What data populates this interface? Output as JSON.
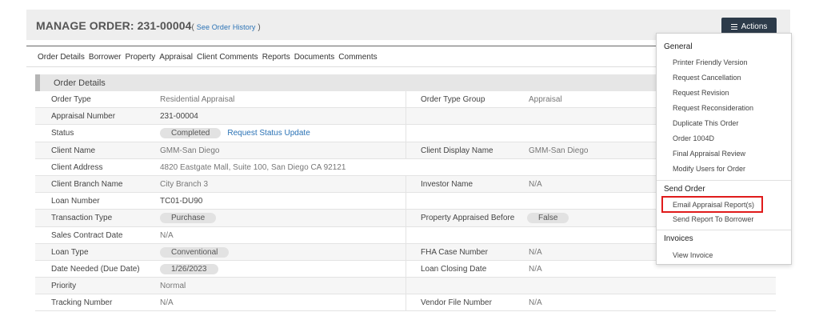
{
  "header": {
    "title_prefix": "MANAGE ORDER: ",
    "order_number": "231-00004",
    "history_open": "( ",
    "history_link": "See Order History",
    "history_close": " )",
    "actions_label": "Actions"
  },
  "tabs": [
    "Order Details",
    "Borrower",
    "Property",
    "Appraisal",
    "Client Comments",
    "Reports",
    "Documents",
    "Comments"
  ],
  "section": {
    "title": "Order Details"
  },
  "rows": [
    {
      "l1": "Order Type",
      "v1": "Residential Appraisal",
      "l2": "Order Type Group",
      "v2": "Appraisal"
    },
    {
      "l1": "Appraisal Number",
      "v1": "231-00004",
      "l2": "",
      "v2": ""
    },
    {
      "l1": "Status",
      "v1": "Completed",
      "v1_link": "Request Status Update",
      "l2": "",
      "v2": ""
    },
    {
      "l1": "Client Name",
      "v1": "GMM-San Diego",
      "l2": "Client Display Name",
      "v2": "GMM-San Diego"
    },
    {
      "l1": "Client Address",
      "v1": "4820 Eastgate Mall, Suite 100, San Diego CA 92121",
      "l2": "",
      "v2": ""
    },
    {
      "l1": "Client Branch Name",
      "v1": "City Branch 3",
      "l2": "Investor Name",
      "v2": "N/A"
    },
    {
      "l1": "Loan Number",
      "v1": "TC01-DU90",
      "l2": "",
      "v2": ""
    },
    {
      "l1": "Transaction Type",
      "v1": "Purchase",
      "l2": "Property Appraised Before",
      "v2": "False"
    },
    {
      "l1": "Sales Contract Date",
      "v1": "N/A",
      "l2": "",
      "v2": ""
    },
    {
      "l1": "Loan Type",
      "v1": "Conventional",
      "l2": "FHA Case Number",
      "v2": "N/A"
    },
    {
      "l1": "Date Needed (Due Date)",
      "v1": "1/26/2023",
      "l2": "Loan Closing Date",
      "v2": "N/A"
    },
    {
      "l1": "Priority",
      "v1": "Normal",
      "l2": "",
      "v2": ""
    },
    {
      "l1": "Tracking Number",
      "v1": "N/A",
      "l2": "Vendor File Number",
      "v2": "N/A"
    }
  ],
  "actions_menu": {
    "general_label": "General",
    "general_items": [
      "Printer Friendly Version",
      "Request Cancellation",
      "Request Revision",
      "Request Reconsideration",
      "Duplicate This Order",
      "Order 1004D",
      "Final Appraisal Review",
      "Modify Users for Order"
    ],
    "send_label": "Send Order",
    "send_items": [
      "Email Appraisal Report(s)",
      "Send Report To Borrower"
    ],
    "invoices_label": "Invoices",
    "invoice_items": [
      "View Invoice"
    ]
  },
  "colors": {
    "actions_bg": "#2d3b4a",
    "link": "#2a72b5",
    "highlight": "#e01b1b"
  }
}
